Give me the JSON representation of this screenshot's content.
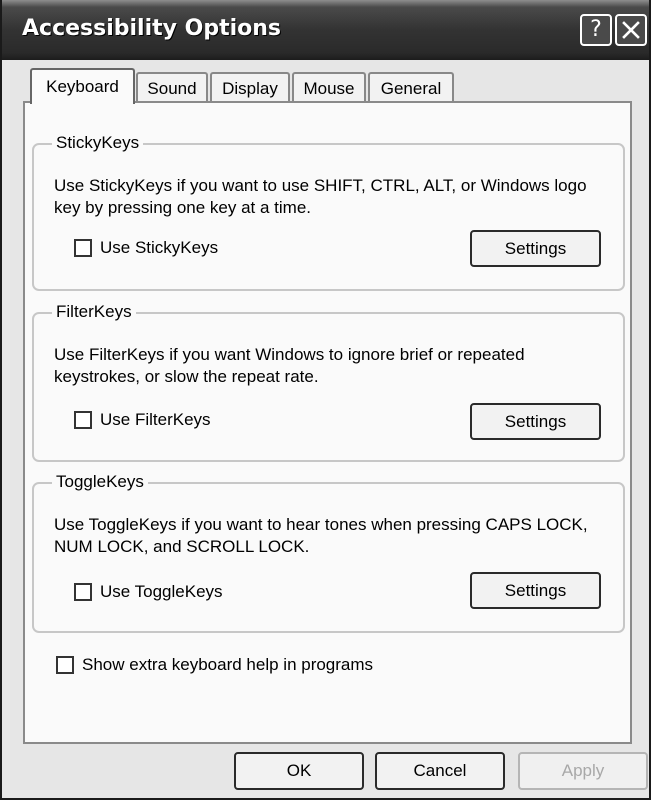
{
  "window": {
    "title": "Accessibility Options",
    "help_glyph": "?"
  },
  "tabs": [
    {
      "label": "Keyboard",
      "active": true
    },
    {
      "label": "Sound"
    },
    {
      "label": "Display"
    },
    {
      "label": "Mouse"
    },
    {
      "label": "General"
    }
  ],
  "groups": {
    "stickykeys": {
      "title": "StickyKeys",
      "description": "Use StickyKeys if you want to use SHIFT, CTRL, ALT, or Windows logo key by pressing one key at a time.",
      "checkbox_label": "Use StickyKeys",
      "checked": false,
      "settings_label": "Settings"
    },
    "filterkeys": {
      "title": "FilterKeys",
      "description": "Use FilterKeys if you want Windows to ignore brief or repeated keystrokes, or slow the repeat rate.",
      "checkbox_label": "Use FilterKeys",
      "checked": false,
      "settings_label": "Settings"
    },
    "togglekeys": {
      "title": "ToggleKeys",
      "description": "Use ToggleKeys if you want to hear tones when pressing CAPS LOCK, NUM LOCK, and SCROLL LOCK.",
      "checkbox_label": "Use ToggleKeys",
      "checked": false,
      "settings_label": "Settings"
    }
  },
  "extra_help": {
    "label": "Show extra keyboard help in programs",
    "checked": false
  },
  "footer": {
    "ok": "OK",
    "cancel": "Cancel",
    "apply": "Apply"
  },
  "icons": {
    "help": "help-icon",
    "close": "close-icon"
  }
}
